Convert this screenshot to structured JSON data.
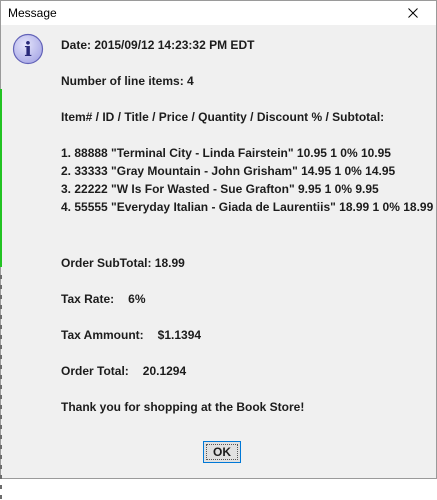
{
  "window": {
    "title": "Message",
    "close_glyph": "✕"
  },
  "icon": {
    "name": "information-icon",
    "letter": "i"
  },
  "message": {
    "date": "Date: 2015/09/12 14:23:32 PM EDT",
    "line_count": "Number of line items: 4",
    "header": "Item# / ID / Title / Price / Quantity / Discount % / Subtotal:",
    "items": [
      "1. 88888  \"Terminal City - Linda Fairstein\" 10.95 1 0% 10.95",
      "2. 33333  \"Gray Mountain - John Grisham\" 14.95 1 0% 14.95",
      "3. 22222  \"W Is For Wasted - Sue Grafton\" 9.95 1 0% 9.95",
      "4. 55555  \"Everyday Italian - Giada de Laurentiis\" 18.99 1 0% 18.99"
    ],
    "subtotal": "Order SubTotal: 18.99",
    "tax_rate_label": "Tax Rate:",
    "tax_rate_value": "6%",
    "tax_amount_label": "Tax Ammount:",
    "tax_amount_value": "$1.1394",
    "total_label": "Order Total:",
    "total_value": "20.1294",
    "thanks": "Thank you for shopping at the Book Store!"
  },
  "buttons": {
    "ok_label": "OK"
  },
  "colors": {
    "background": "#f0f0f0",
    "icon_fill": "#b7b7ec",
    "icon_border": "#5a5ab4",
    "focus_border": "#0078d7",
    "left_strip": "#22c322"
  }
}
